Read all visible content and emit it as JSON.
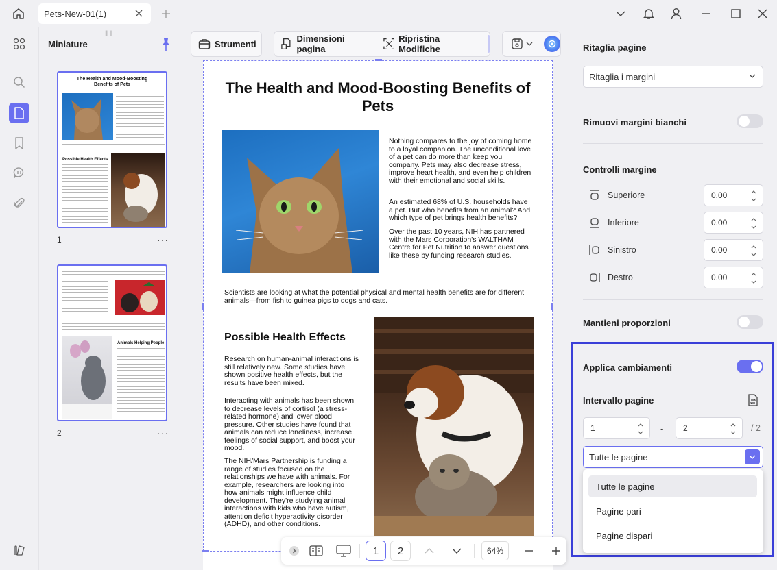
{
  "titlebar": {
    "tab_title": "Pets-New-01(1)"
  },
  "thumbnails": {
    "title": "Miniature",
    "pages": [
      {
        "number": "1",
        "mini_title": "The Health and Mood-Boosting Benefits of Pets",
        "mini_heading": "Possible Health Effects"
      },
      {
        "number": "2",
        "mini_heading": "Animals Helping People"
      }
    ],
    "more": "···"
  },
  "toolbar": {
    "tools_label": "Strumenti",
    "page_size_label": "Dimensioni pagina",
    "reset_label": "Ripristina Modifiche"
  },
  "document": {
    "title": "The Health and Mood-Boosting Benefits of Pets",
    "para1": "Nothing compares to the joy of coming home to a loyal companion. The unconditional love of a pet can do more than keep you company. Pets may also decrease stress, improve heart health, and even help children with their emotional and social skills.",
    "para2": "An estimated 68% of U.S. households have a pet. But who benefits from an animal? And which type of pet brings health benefits?",
    "para3": "Over the past 10 years, NIH has partnered with the Mars Corporation's WALTHAM Centre for Pet Nutrition to answer questions like these by funding research studies.",
    "para4": "Scientists are looking at what the potential physical and mental health benefits are for different animals—from fish to guinea pigs to dogs and cats.",
    "heading2": "Possible Health Effects",
    "para5": "Research on human-animal interactions is still relatively new. Some studies have shown positive health effects, but the results have been mixed.",
    "para6": "Interacting with animals has been shown to decrease levels of cortisol (a stress-related hormone) and lower blood pressure. Other studies have found that animals can reduce loneliness, increase feelings of social support, and boost your mood.",
    "para7": "The NIH/Mars Partnership is funding a range of studies focused on the relationships we have with animals. For example, researchers are looking into how animals might influence child development. They're studying animal interactions with kids who have autism, attention deficit hyperactivity disorder (ADHD), and other conditions."
  },
  "bottombar": {
    "page1": "1",
    "page2": "2",
    "zoom": "64%"
  },
  "rightpanel": {
    "crop_title": "Ritaglia pagine",
    "crop_select": "Ritaglia i margini",
    "remove_white_label": "Rimuovi margini bianchi",
    "remove_white_on": false,
    "margin_controls_title": "Controlli margine",
    "margins": [
      {
        "label": "Superiore",
        "value": "0.00"
      },
      {
        "label": "Inferiore",
        "value": "0.00"
      },
      {
        "label": "Sinistro",
        "value": "0.00"
      },
      {
        "label": "Destro",
        "value": "0.00"
      }
    ],
    "keep_ratio_label": "Mantieni proporzioni",
    "keep_ratio_on": false,
    "apply_label": "Applica cambiamenti",
    "apply_on": true,
    "range_title": "Intervallo pagine",
    "range_from": "1",
    "range_dash": "-",
    "range_to": "2",
    "range_total": "/ 2",
    "range_select": "Tutte le pagine",
    "range_options": [
      "Tutte le pagine",
      "Pagine pari",
      "Pagine dispari"
    ]
  },
  "colors": {
    "accent": "#6a6ff0",
    "highlight_border": "#3a3fd8",
    "panel_bg": "#f0f0f3"
  }
}
